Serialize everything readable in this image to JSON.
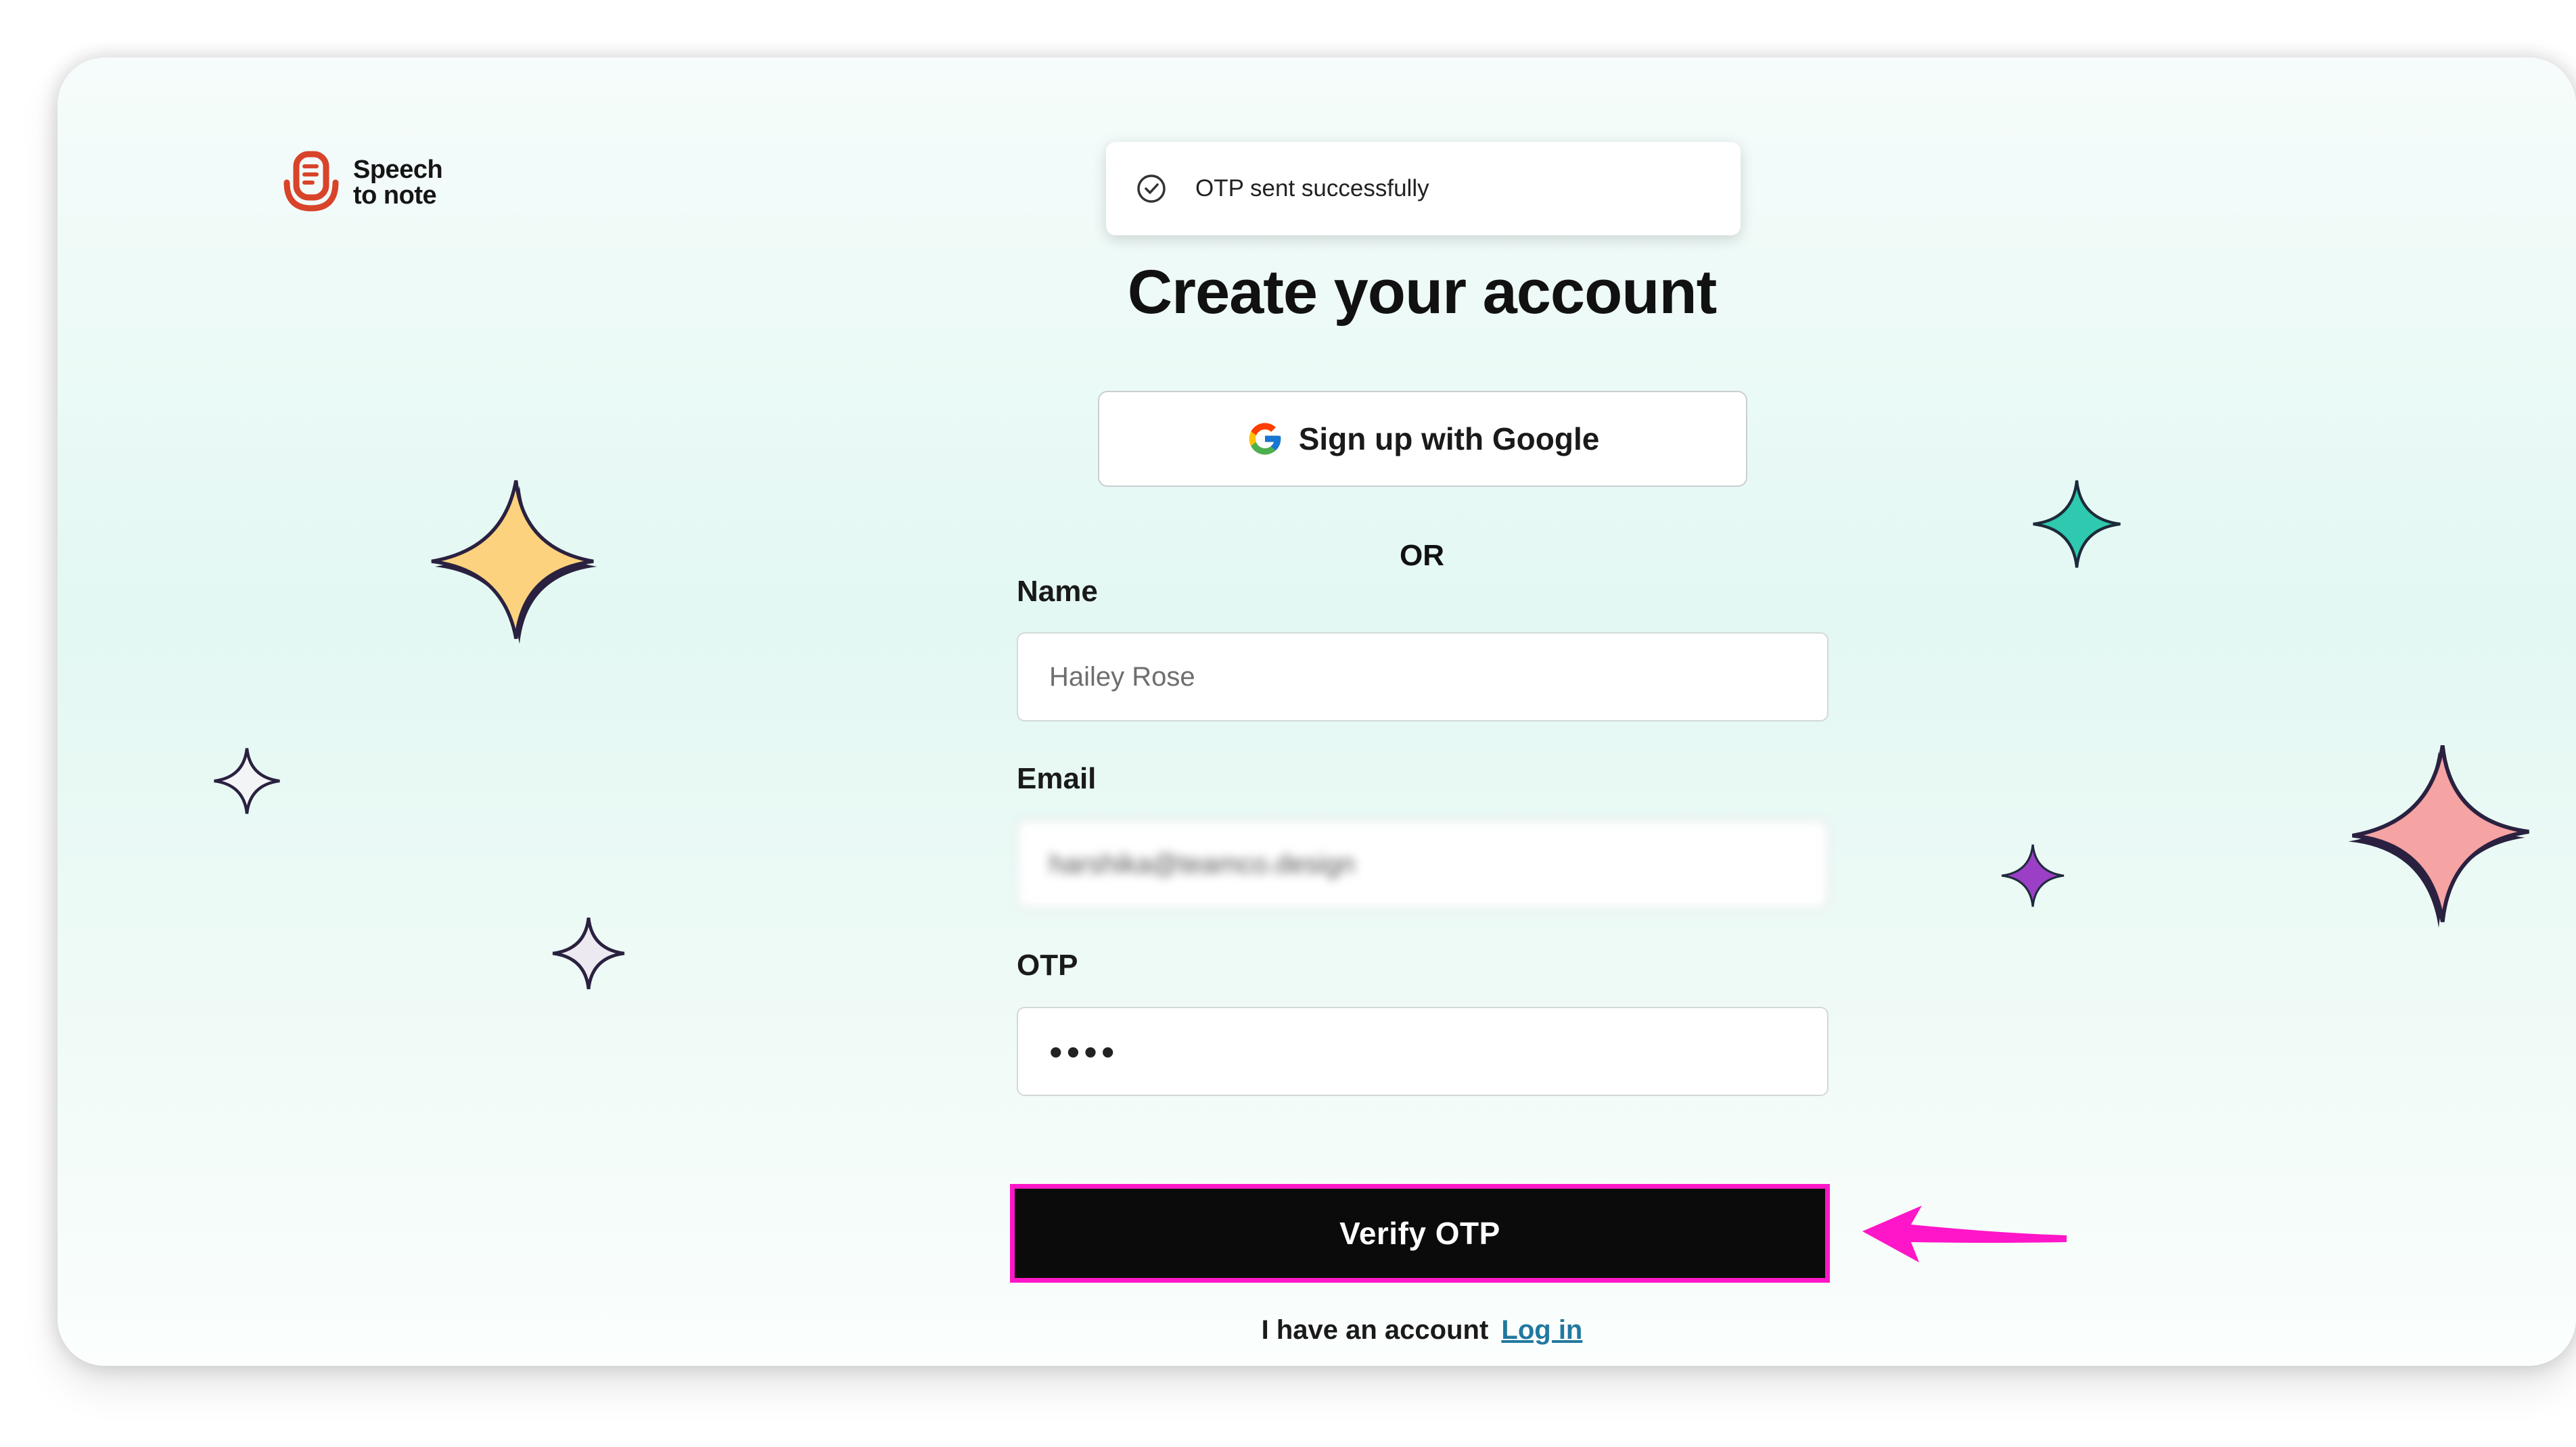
{
  "brand": {
    "name_line1": "Speech",
    "name_line2": "to note",
    "color": "#d8432a"
  },
  "toast": {
    "icon": "check-circle-icon",
    "message": "OTP sent successfully"
  },
  "page": {
    "title": "Create your account"
  },
  "google": {
    "label": "Sign up with Google",
    "icon": "google-icon"
  },
  "divider": {
    "text": "OR"
  },
  "form": {
    "name_label": "Name",
    "name_placeholder": "Hailey Rose",
    "email_label": "Email",
    "email_value": "harshika@teamco.design",
    "otp_label": "OTP",
    "otp_value": "••••",
    "submit_label": "Verify OTP"
  },
  "footer": {
    "prompt": "I have an account",
    "login_link": "Log in"
  },
  "colors": {
    "highlight": "#ff16c8",
    "sparkle_yellow": "#fcd27e",
    "sparkle_teal": "#2ec9ae",
    "sparkle_pink": "#f6a3a3",
    "sparkle_purple": "#9b3fc6",
    "link": "#2178a0"
  }
}
